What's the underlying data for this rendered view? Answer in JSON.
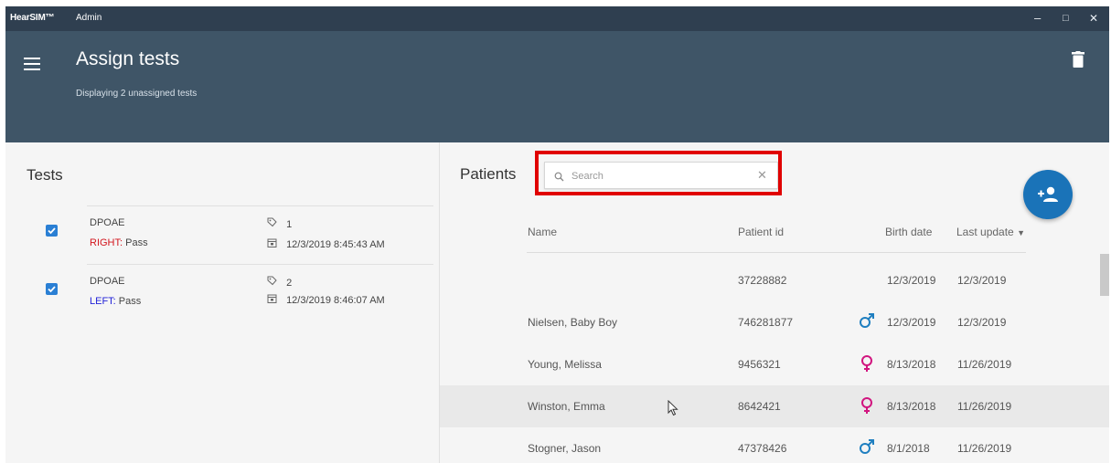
{
  "window": {
    "app_name": "HearSIM™",
    "mode": "Admin",
    "minimize": "–",
    "maximize": "□",
    "close": "✕"
  },
  "header": {
    "title": "Assign tests",
    "subtitle": "Displaying 2 unassigned tests",
    "menu_icon": "hamburger-menu-icon",
    "delete_icon": "trash-icon"
  },
  "tests_panel": {
    "title": "Tests",
    "items": [
      {
        "checked": true,
        "name": "DPOAE",
        "ear_label": "RIGHT:",
        "ear": "right",
        "result": "Pass",
        "id": "1",
        "date": "12/3/2019 8:45:43 AM"
      },
      {
        "checked": true,
        "name": "DPOAE",
        "ear_label": "LEFT:",
        "ear": "left",
        "result": "Pass",
        "id": "2",
        "date": "12/3/2019 8:46:07 AM"
      }
    ]
  },
  "patients_panel": {
    "title": "Patients",
    "search": {
      "placeholder": "Search",
      "value": ""
    },
    "add_patient_icon": "add-person-icon",
    "columns": {
      "name": "Name",
      "patient_id": "Patient id",
      "birth_date": "Birth date",
      "last_update": "Last update"
    },
    "sort_indicator": "▼",
    "rows": [
      {
        "name": "",
        "patient_id": "37228882",
        "gender": "",
        "birth_date": "12/3/2019",
        "last_update": "12/3/2019",
        "selected": false
      },
      {
        "name": "Nielsen, Baby Boy",
        "patient_id": "746281877",
        "gender": "male",
        "birth_date": "12/3/2019",
        "last_update": "12/3/2019",
        "selected": false
      },
      {
        "name": "Young, Melissa",
        "patient_id": "9456321",
        "gender": "female",
        "birth_date": "8/13/2018",
        "last_update": "11/26/2019",
        "selected": false
      },
      {
        "name": "Winston, Emma",
        "patient_id": "8642421",
        "gender": "female",
        "birth_date": "8/13/2018",
        "last_update": "11/26/2019",
        "selected": true
      },
      {
        "name": "Stogner, Jason",
        "patient_id": "47378426",
        "gender": "male",
        "birth_date": "8/1/2018",
        "last_update": "11/26/2019",
        "selected": false
      }
    ]
  },
  "colors": {
    "titlebar": "#2f3f50",
    "header": "#3f5567",
    "accent": "#1a73b8",
    "right_ear": "#d3171f",
    "left_ear": "#2323d8",
    "male": "#1f7fc0",
    "female": "#d1157f",
    "highlight": "#e00000"
  }
}
